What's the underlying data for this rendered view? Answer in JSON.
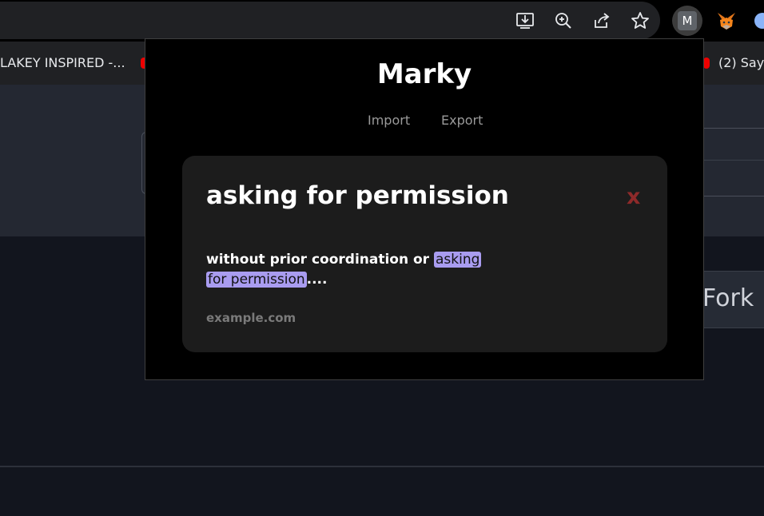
{
  "browser": {
    "toolbar_icons": [
      "install-icon",
      "zoom-icon",
      "share-icon",
      "bookmark-star-icon"
    ],
    "extensions": {
      "marky_letter": "M",
      "fox_icon": "metamask-fox-icon"
    },
    "bookmarks": [
      {
        "label": "LAKEY INSPIRED -..."
      },
      {
        "label": "(2) Say"
      }
    ]
  },
  "page": {
    "fork_label": "Fork"
  },
  "popup": {
    "title": "Marky",
    "nav": {
      "import_label": "Import",
      "export_label": "Export"
    },
    "card": {
      "title": "asking for permission",
      "close_label": "x",
      "excerpt_before": "without prior coordination or ",
      "highlight_part1": "asking",
      "highlight_part2": "for permission",
      "excerpt_after": "....",
      "source": "example.com"
    }
  },
  "colors": {
    "highlight": "#a99cf0",
    "close": "#8e2a2a"
  }
}
